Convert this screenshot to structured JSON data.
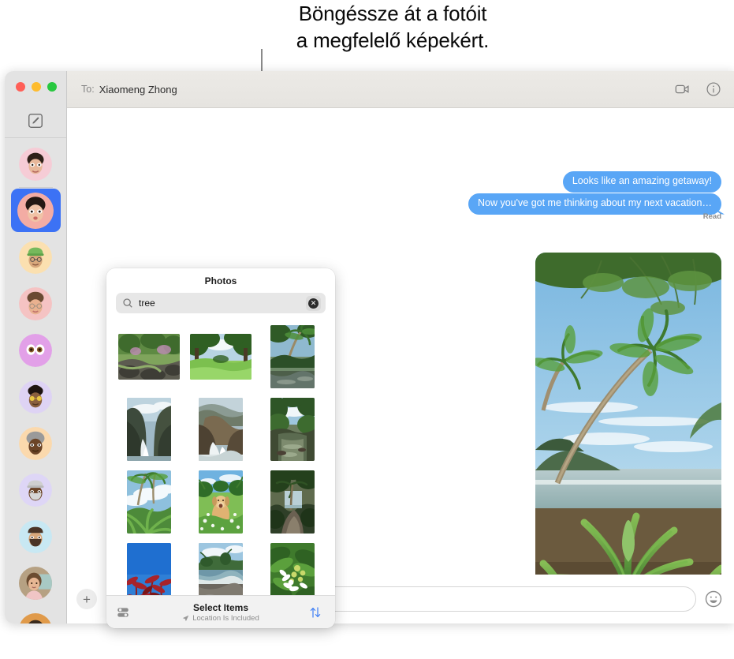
{
  "callout": {
    "line1": "Böngéssze át a fotóit",
    "line2": "a megfelelő képekért."
  },
  "window": {
    "traffic_lights": [
      {
        "name": "close",
        "color": "#ff5f57"
      },
      {
        "name": "minimize",
        "color": "#febc2e"
      },
      {
        "name": "zoom",
        "color": "#28c840"
      }
    ],
    "titlebar": {
      "to_label": "To:",
      "recipient": "Xiaomeng Zhong",
      "facetime_icon": "video-camera-icon",
      "info_icon": "info-circle-icon"
    }
  },
  "sidebar": {
    "compose_icon": "compose-icon",
    "conversations": [
      {
        "name": "conversation-1",
        "avatar": "memoji-woman-pink",
        "bg": "#f6ccd6",
        "selected": false
      },
      {
        "name": "conversation-2",
        "avatar": "memoji-woman-pout",
        "bg": "#f6b8b0",
        "selected": true
      },
      {
        "name": "conversation-3",
        "avatar": "memoji-green-beanie",
        "bg": "#fbe0b0",
        "selected": false
      },
      {
        "name": "conversation-4",
        "avatar": "memoji-woman-glasses",
        "bg": "#f5c3c3",
        "selected": false
      },
      {
        "name": "conversation-5",
        "avatar": "memoji-eyes",
        "bg": "#e8a6ee",
        "selected": false
      },
      {
        "name": "conversation-6",
        "avatar": "memoji-yellow-sunglasses",
        "bg": "#ded3f4",
        "selected": false
      },
      {
        "name": "conversation-7",
        "avatar": "memoji-gray-hair",
        "bg": "#fbd9ad",
        "selected": false
      },
      {
        "name": "conversation-8",
        "avatar": "memoji-beard-cap",
        "bg": "#ded6f6",
        "selected": false
      },
      {
        "name": "conversation-9",
        "avatar": "memoji-beard-hat",
        "bg": "#c8e8f3",
        "selected": false
      },
      {
        "name": "conversation-10",
        "avatar": "photo-person-short-hair",
        "bg": "#cbb89a",
        "selected": false
      },
      {
        "name": "conversation-11",
        "avatar": "photo-person-orange",
        "bg": "#e09a4a",
        "selected": false
      }
    ]
  },
  "conversation": {
    "messages": [
      {
        "text": "Looks like an amazing getaway!",
        "sender": "me"
      },
      {
        "text": "Now you've got me thinking about my next vacation…",
        "sender": "me"
      }
    ],
    "status": "Read",
    "attachment": {
      "name": "tropical-beach-photo",
      "alt": "Palm trees over a tropical beach with green foliage in the foreground"
    }
  },
  "input_bar": {
    "add_icon": "plus-icon",
    "message_placeholder": "",
    "message_value": "",
    "emoji_icon": "smiley-icon"
  },
  "photos_popover": {
    "title": "Photos",
    "search": {
      "icon": "search-icon",
      "value": "tree",
      "placeholder": "Search",
      "clear_icon": "clear-circle-icon"
    },
    "photos": [
      {
        "name": "photo-mossy-rocks-forest",
        "orient": "land",
        "id": 1
      },
      {
        "name": "photo-green-meadow-trees",
        "orient": "land",
        "id": 2
      },
      {
        "name": "photo-palm-over-river",
        "orient": "port",
        "id": 3
      },
      {
        "name": "photo-rocky-coast-cliffs",
        "orient": "port",
        "id": 4
      },
      {
        "name": "photo-sea-stack-surf",
        "orient": "port",
        "id": 5
      },
      {
        "name": "photo-jungle-river",
        "orient": "port",
        "id": 6
      },
      {
        "name": "photo-palms-blue-sky",
        "orient": "port",
        "id": 7
      },
      {
        "name": "photo-dog-in-flowers",
        "orient": "port",
        "id": 8
      },
      {
        "name": "photo-palm-path-ocean",
        "orient": "port",
        "id": 9
      },
      {
        "name": "photo-red-leaves-sky",
        "orient": "port",
        "id": 10
      },
      {
        "name": "photo-beach-shoreline",
        "orient": "port",
        "id": 11
      },
      {
        "name": "photo-white-blossoms",
        "orient": "port",
        "id": 12
      }
    ],
    "footer": {
      "layout_icon": "library-layout-icon",
      "title": "Select Items",
      "location_icon": "location-arrow-icon",
      "location_text": "Location Is Included",
      "sort_icon": "sort-arrows-icon"
    }
  },
  "colors": {
    "bubble_blue": "#59a6f6",
    "selection_blue": "#3c72f5",
    "accent_blue": "#3c7df5",
    "sidebar_bg": "#e3e3e3",
    "titlebar_bg": "#eceae6"
  }
}
